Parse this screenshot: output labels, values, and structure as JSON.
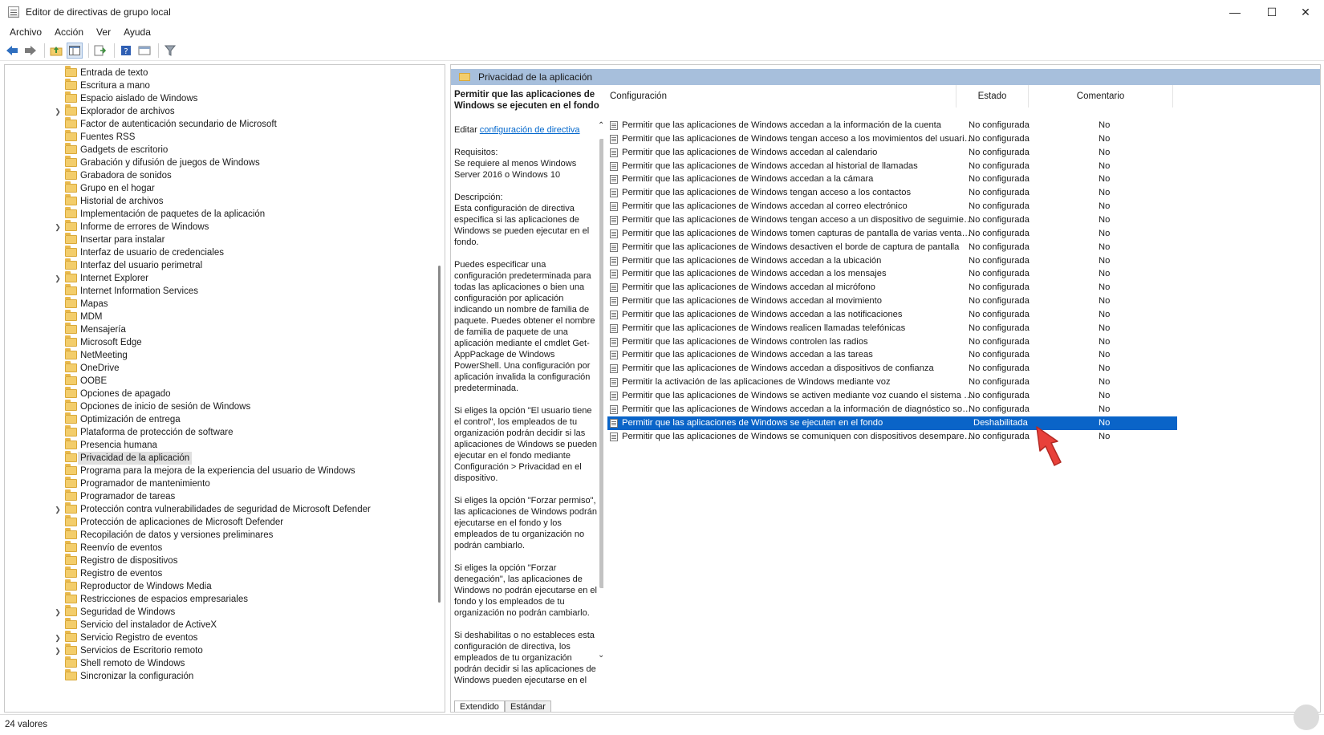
{
  "window": {
    "title": "Editor de directivas de grupo local",
    "minimize_icon": "minimize-icon",
    "maximize_icon": "maximize-icon",
    "close_icon": "close-icon"
  },
  "menu": [
    "Archivo",
    "Acción",
    "Ver",
    "Ayuda"
  ],
  "toolbar": {
    "icons": [
      "back-icon",
      "forward-icon",
      "up-folder-icon",
      "show-hide-tree-icon",
      "export-list-icon",
      "help-icon",
      "properties-icon",
      "filter-icon"
    ]
  },
  "tree": {
    "items": [
      {
        "label": "Entrada de texto",
        "expandable": false
      },
      {
        "label": "Escritura a mano",
        "expandable": false
      },
      {
        "label": "Espacio aislado de Windows",
        "expandable": false
      },
      {
        "label": "Explorador de archivos",
        "expandable": true
      },
      {
        "label": "Factor de autenticación secundario de Microsoft",
        "expandable": false
      },
      {
        "label": "Fuentes RSS",
        "expandable": false
      },
      {
        "label": "Gadgets de escritorio",
        "expandable": false
      },
      {
        "label": "Grabación y difusión de juegos de Windows",
        "expandable": false
      },
      {
        "label": "Grabadora de sonidos",
        "expandable": false
      },
      {
        "label": "Grupo en el hogar",
        "expandable": false
      },
      {
        "label": "Historial de archivos",
        "expandable": false
      },
      {
        "label": "Implementación de paquetes de la aplicación",
        "expandable": false
      },
      {
        "label": "Informe de errores de Windows",
        "expandable": true
      },
      {
        "label": "Insertar para instalar",
        "expandable": false
      },
      {
        "label": "Interfaz de usuario de credenciales",
        "expandable": false
      },
      {
        "label": "Interfaz del usuario perimetral",
        "expandable": false
      },
      {
        "label": "Internet Explorer",
        "expandable": true
      },
      {
        "label": "Internet Information Services",
        "expandable": false
      },
      {
        "label": "Mapas",
        "expandable": false
      },
      {
        "label": "MDM",
        "expandable": false
      },
      {
        "label": "Mensajería",
        "expandable": false
      },
      {
        "label": "Microsoft Edge",
        "expandable": false
      },
      {
        "label": "NetMeeting",
        "expandable": false
      },
      {
        "label": "OneDrive",
        "expandable": false
      },
      {
        "label": "OOBE",
        "expandable": false
      },
      {
        "label": "Opciones de apagado",
        "expandable": false
      },
      {
        "label": "Opciones de inicio de sesión de Windows",
        "expandable": false
      },
      {
        "label": "Optimización de entrega",
        "expandable": false
      },
      {
        "label": "Plataforma de protección de software",
        "expandable": false
      },
      {
        "label": "Presencia humana",
        "expandable": false
      },
      {
        "label": "Privacidad de la aplicación",
        "expandable": false,
        "selected": true
      },
      {
        "label": "Programa para la mejora de la experiencia del usuario de Windows",
        "expandable": false
      },
      {
        "label": "Programador de mantenimiento",
        "expandable": false
      },
      {
        "label": "Programador de tareas",
        "expandable": false
      },
      {
        "label": "Protección contra vulnerabilidades de seguridad de Microsoft Defender",
        "expandable": true
      },
      {
        "label": "Protección de aplicaciones de Microsoft Defender",
        "expandable": false
      },
      {
        "label": "Recopilación de datos y versiones preliminares",
        "expandable": false
      },
      {
        "label": "Reenvío de eventos",
        "expandable": false
      },
      {
        "label": "Registro de dispositivos",
        "expandable": false
      },
      {
        "label": "Registro de eventos",
        "expandable": false
      },
      {
        "label": "Reproductor de Windows Media",
        "expandable": false
      },
      {
        "label": "Restricciones de espacios empresariales",
        "expandable": false
      },
      {
        "label": "Seguridad de Windows",
        "expandable": true
      },
      {
        "label": "Servicio del instalador de ActiveX",
        "expandable": false
      },
      {
        "label": "Servicio Registro de eventos",
        "expandable": true
      },
      {
        "label": "Servicios de Escritorio remoto",
        "expandable": true
      },
      {
        "label": "Shell remoto de Windows",
        "expandable": false
      },
      {
        "label": "Sincronizar la configuración",
        "expandable": false
      }
    ]
  },
  "pane_header": "Privacidad de la aplicación",
  "description": {
    "title": "Permitir que las aplicaciones de Windows se ejecuten en el fondo",
    "edit_prefix": "Editar ",
    "edit_link": "configuración de directiva",
    "requirements_label": "Requisitos:",
    "requirements": "Se requiere al menos Windows Server 2016 o Windows 10",
    "description_label": "Descripción:",
    "paragraphs": [
      "Esta configuración de directiva especifica si las aplicaciones de Windows se pueden ejecutar en el fondo.",
      "Puedes especificar una configuración predeterminada para todas las aplicaciones o bien una configuración por aplicación indicando un nombre de familia de paquete. Puedes obtener el nombre de familia de paquete de una aplicación mediante el cmdlet Get-AppPackage de Windows PowerShell. Una configuración por aplicación invalida la configuración predeterminada.",
      "Si eliges la opción \"El usuario tiene el control\", los empleados de tu organización podrán decidir si las aplicaciones de Windows se pueden ejecutar en el fondo mediante Configuración > Privacidad en el dispositivo.",
      "Si eliges la opción \"Forzar permiso\", las aplicaciones de Windows podrán ejecutarse en el fondo y los empleados de tu organización no podrán cambiarlo.",
      "Si eliges la opción \"Forzar denegación\", las aplicaciones de Windows no podrán ejecutarse en el fondo y los empleados de tu organización no podrán cambiarlo.",
      "Si deshabilitas o no estableces esta configuración de directiva, los empleados de tu organización podrán decidir si las aplicaciones de Windows pueden ejecutarse en el fondo mediante Configuración"
    ]
  },
  "tabs": [
    "Extendido",
    "Estándar"
  ],
  "list": {
    "columns": [
      "Configuración",
      "Estado",
      "Comentario"
    ],
    "rows": [
      {
        "name": "Permitir que las aplicaciones de Windows accedan a la información de la cuenta",
        "state": "No configurada",
        "comment": "No"
      },
      {
        "name": "Permitir que las aplicaciones de Windows tengan acceso a los movimientos del usuario ...",
        "state": "No configurada",
        "comment": "No"
      },
      {
        "name": "Permitir que las aplicaciones de Windows accedan al calendario",
        "state": "No configurada",
        "comment": "No"
      },
      {
        "name": "Permitir que las aplicaciones de Windows accedan al historial de llamadas",
        "state": "No configurada",
        "comment": "No"
      },
      {
        "name": "Permitir que las aplicaciones de Windows accedan a la cámara",
        "state": "No configurada",
        "comment": "No"
      },
      {
        "name": "Permitir que las aplicaciones de Windows tengan acceso a los contactos",
        "state": "No configurada",
        "comment": "No"
      },
      {
        "name": "Permitir que las aplicaciones de Windows accedan al correo electrónico",
        "state": "No configurada",
        "comment": "No"
      },
      {
        "name": "Permitir que las aplicaciones de Windows tengan acceso a un dispositivo de seguimient...",
        "state": "No configurada",
        "comment": "No"
      },
      {
        "name": "Permitir que las aplicaciones de Windows tomen capturas de pantalla de varias ventana...",
        "state": "No configurada",
        "comment": "No"
      },
      {
        "name": "Permitir que las aplicaciones de Windows desactiven el borde de captura de pantalla",
        "state": "No configurada",
        "comment": "No"
      },
      {
        "name": "Permitir que las aplicaciones de Windows accedan a la ubicación",
        "state": "No configurada",
        "comment": "No"
      },
      {
        "name": "Permitir que las aplicaciones de Windows accedan a los mensajes",
        "state": "No configurada",
        "comment": "No"
      },
      {
        "name": "Permitir que las aplicaciones de Windows accedan al micrófono",
        "state": "No configurada",
        "comment": "No"
      },
      {
        "name": "Permitir que las aplicaciones de Windows accedan al movimiento",
        "state": "No configurada",
        "comment": "No"
      },
      {
        "name": "Permitir que las aplicaciones de Windows accedan a las notificaciones",
        "state": "No configurada",
        "comment": "No"
      },
      {
        "name": "Permitir que las aplicaciones de Windows realicen llamadas telefónicas",
        "state": "No configurada",
        "comment": "No"
      },
      {
        "name": "Permitir que las aplicaciones de Windows controlen las radios",
        "state": "No configurada",
        "comment": "No"
      },
      {
        "name": "Permitir que las aplicaciones de Windows accedan a las tareas",
        "state": "No configurada",
        "comment": "No"
      },
      {
        "name": "Permitir que las aplicaciones de Windows accedan a dispositivos de confianza",
        "state": "No configurada",
        "comment": "No"
      },
      {
        "name": "Permitir la activación de las aplicaciones de Windows mediante voz",
        "state": "No configurada",
        "comment": "No"
      },
      {
        "name": "Permitir que las aplicaciones de Windows se activen mediante voz cuando el sistema es...",
        "state": "No configurada",
        "comment": "No"
      },
      {
        "name": "Permitir que las aplicaciones de Windows accedan a la información de diagnóstico sobr...",
        "state": "No configurada",
        "comment": "No"
      },
      {
        "name": "Permitir que las aplicaciones de Windows se ejecuten en el fondo",
        "state": "Deshabilitada",
        "comment": "No",
        "selected": true
      },
      {
        "name": "Permitir que las aplicaciones de Windows se comuniquen con dispositivos desempareja...",
        "state": "No configurada",
        "comment": "No"
      }
    ]
  },
  "status_bar": "24 valores",
  "accent_color": "#0a64c8",
  "header_color": "#a7bfdc",
  "pointer_color": "#e8413a"
}
